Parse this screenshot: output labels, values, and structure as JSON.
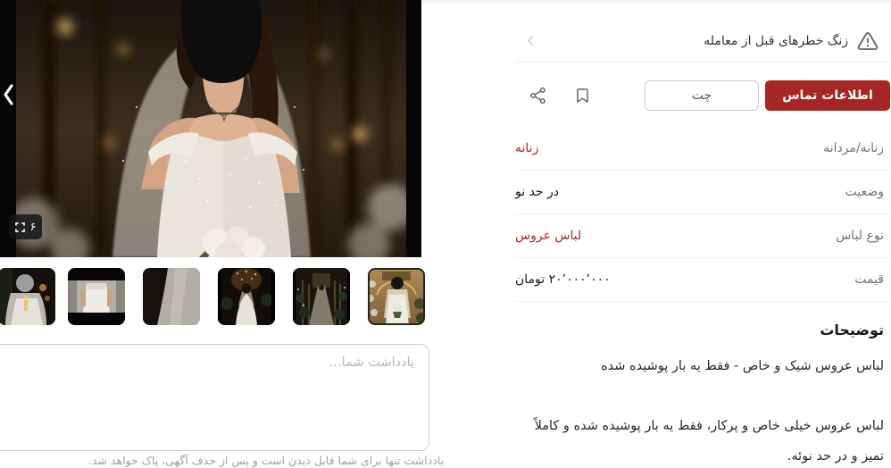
{
  "safety": {
    "title": "زنگ خطرهای قبل از معامله"
  },
  "actions": {
    "contact": "اطلاعات تماس",
    "chat": "چت"
  },
  "attributes": [
    {
      "label": "زنانه/مردانه",
      "value": "زنانه"
    },
    {
      "label": "وضعیت",
      "value": "در حد نو"
    },
    {
      "label": "نوع لباس",
      "value": "لباس عروس"
    },
    {
      "label": "قیمت",
      "value": "۲۰٬۰۰۰٬۰۰۰ تومان"
    }
  ],
  "description": {
    "heading": "توضیحات",
    "body": "لباس عروس شیک و خاص - فقط یه بار پوشیده شده\n\nلباس عروس خیلی خاص و پرکار، فقط یه بار پوشیده شده و کاملاً\nتمیز و در حد نوئه."
  },
  "gallery": {
    "image_count": "۶"
  },
  "note": {
    "placeholder": "یادداشت شما...",
    "helper": "یادداشت تنها برای شما قابل دیدن است و پس از حذف آگهی، پاک خواهد شد."
  },
  "colors": {
    "brand_red": "#a62626",
    "link_red": "#a62626",
    "selected_thumb_border": "#242424"
  }
}
